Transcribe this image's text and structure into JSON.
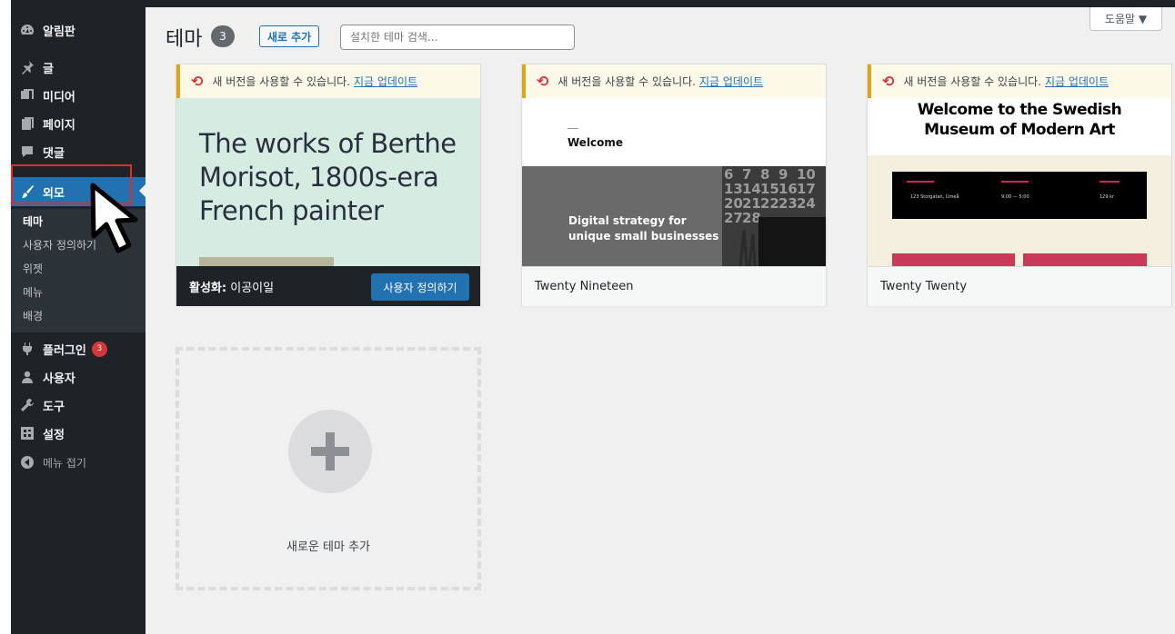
{
  "sidebar": {
    "items": [
      {
        "label": "알림판",
        "icon": "dashboard-icon"
      },
      {
        "label": "글",
        "icon": "pin-icon"
      },
      {
        "label": "미디어",
        "icon": "media-icon"
      },
      {
        "label": "페이지",
        "icon": "page-icon"
      },
      {
        "label": "댓글",
        "icon": "comment-icon"
      },
      {
        "label": "외모",
        "icon": "brush-icon"
      },
      {
        "label": "플러그인",
        "icon": "plugin-icon",
        "badge": "3"
      },
      {
        "label": "사용자",
        "icon": "user-icon"
      },
      {
        "label": "도구",
        "icon": "wrench-icon"
      },
      {
        "label": "설정",
        "icon": "settings-icon"
      },
      {
        "label": "메뉴 접기",
        "icon": "collapse-icon"
      }
    ],
    "submenu": [
      "테마",
      "사용자 정의하기",
      "위젯",
      "메뉴",
      "배경"
    ]
  },
  "header": {
    "help": "도움말 ▼",
    "title": "테마",
    "count": "3",
    "add_new": "새로 추가",
    "search_placeholder": "설치한 테마 검색..."
  },
  "themes": [
    {
      "notice": "새 버전을 사용할 수 있습니다.",
      "notice_link": "지금 업데이트",
      "screenshot_text": "The works of Berthe Morisot, 1800s-era French painter",
      "active_prefix": "활성화:",
      "name": "이공이일",
      "customize": "사용자 정의하기"
    },
    {
      "notice": "새 버전을 사용할 수 있습니다.",
      "notice_link": "지금 업데이트",
      "screenshot_welcome": "Welcome",
      "screenshot_tagline": "Digital strategy for unique small businesses",
      "name": "Twenty Nineteen"
    },
    {
      "notice": "새 버전을 사용할 수 있습니다.",
      "notice_link": "지금 업데이트",
      "screenshot_title": "Welcome to the Swedish Museum of Modern Art",
      "screenshot_address": "123 Storgatan, Umeå",
      "screenshot_hours": "9:00 — 5:00",
      "screenshot_price": "129 kr",
      "name": "Twenty Twenty"
    }
  ],
  "add_theme": {
    "label": "새로운 테마 추가"
  },
  "colors": {
    "sidebar_bg": "#1d2327",
    "accent": "#2271b1",
    "badge": "#d63638",
    "highlight": "#e12a2a"
  }
}
